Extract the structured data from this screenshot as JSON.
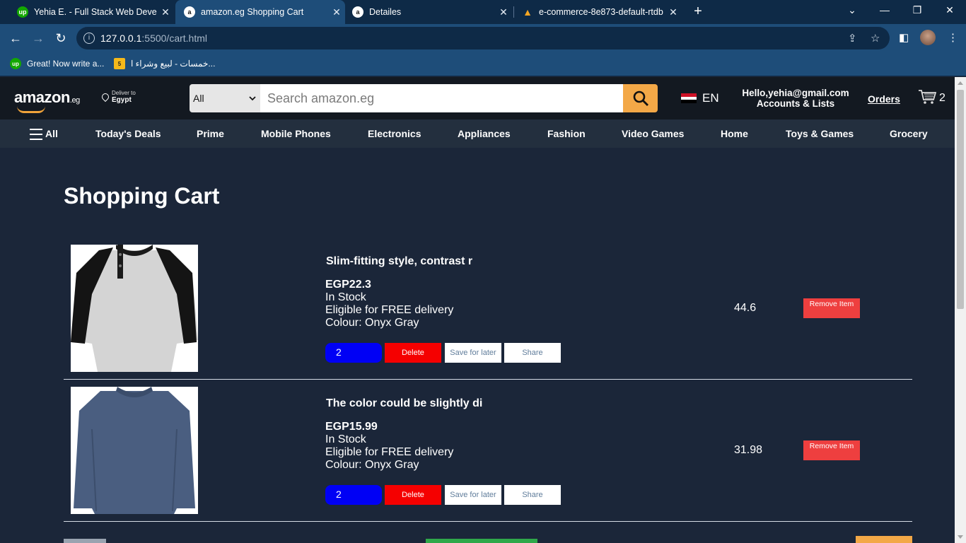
{
  "browser": {
    "tabs": [
      {
        "title": "Yehia E. - Full Stack Web Develop",
        "favicon": "upwork-icon",
        "active": false
      },
      {
        "title": "amazon.eg Shopping Cart",
        "favicon": "amazon-icon",
        "active": true
      },
      {
        "title": "Detailes",
        "favicon": "amazon-icon",
        "active": false
      },
      {
        "title": "e-commerce-8e873-default-rtdb",
        "favicon": "firebase-icon",
        "active": false
      }
    ],
    "url_host": "127.0.0.1",
    "url_rest": ":5500/cart.html",
    "bookmarks": [
      {
        "label": "Great! Now write a...",
        "icon": "upwork-icon"
      },
      {
        "label": "خمسات - لبيع وشراء ا...",
        "icon": "khamsat-icon"
      }
    ]
  },
  "header": {
    "logo_text": "amazon",
    "logo_suffix": ".eg",
    "deliver_small": "Deliver to",
    "deliver_big": "Egypt",
    "search_category": "All",
    "search_placeholder": "Search amazon.eg",
    "language": "EN",
    "account_greeting": "Hello,yehia@gmail.com",
    "account_sub": "Accounts & Lists",
    "orders": "Orders",
    "cart_count": "2"
  },
  "nav": {
    "all": "All",
    "items": [
      "Today's Deals",
      "Prime",
      "Mobile Phones",
      "Electronics",
      "Appliances",
      "Fashion",
      "Video Games",
      "Home",
      "Toys & Games",
      "Grocery"
    ]
  },
  "cart": {
    "title": "Shopping Cart",
    "items": [
      {
        "name": "Slim-fitting style, contrast r",
        "price": "EGP22.3",
        "stock": "In Stock",
        "delivery": "Eligible for FREE delivery",
        "colour": "Colour: Onyx Gray",
        "quantity": "2",
        "delete": "Delete",
        "save": "Save for later",
        "share": "Share",
        "subtotal": "44.6",
        "remove": "Remove Item"
      },
      {
        "name": "The color could be slightly di",
        "price": "EGP15.99",
        "stock": "In Stock",
        "delivery": "Eligible for FREE delivery",
        "colour": "Colour: Onyx Gray",
        "quantity": "2",
        "delete": "Delete",
        "save": "Save for later",
        "share": "Share",
        "subtotal": "31.98",
        "remove": "Remove Item"
      }
    ]
  },
  "colors": {
    "page_bg": "#1b2639",
    "header_bg": "#131921",
    "nav_bg": "#232f3e",
    "accent": "#f3a847",
    "qty_bg": "#0000f5",
    "delete_bg": "#f50000",
    "remove_bg": "#ee3f3f"
  }
}
